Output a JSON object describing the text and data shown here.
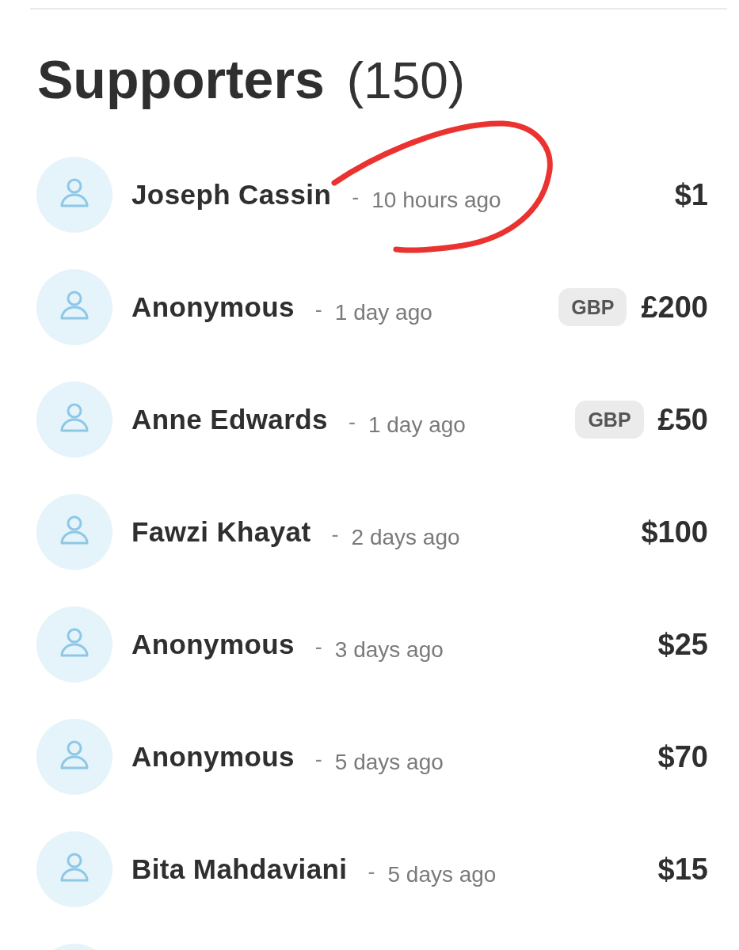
{
  "header": {
    "title": "Supporters",
    "count": "(150)"
  },
  "rows": [
    {
      "name": "Joseph Cassin",
      "separator": "-",
      "time": "10 hours ago",
      "amount": "$1",
      "circled": true
    },
    {
      "name": "Anonymous",
      "separator": "-",
      "time": "1 day ago",
      "currency": "GBP",
      "amount": "£200",
      "circled": false
    },
    {
      "name": "Anne Edwards",
      "separator": "-",
      "time": "1 day ago",
      "currency": "GBP",
      "amount": "£50",
      "circled": false
    },
    {
      "name": "Fawzi Khayat",
      "separator": "-",
      "time": "2 days ago",
      "amount": "$100",
      "circled": false
    },
    {
      "name": "Anonymous",
      "separator": "-",
      "time": "3 days ago",
      "amount": "$25",
      "circled": false
    },
    {
      "name": "Anonymous",
      "separator": "-",
      "time": "5 days ago",
      "amount": "$70",
      "circled": false
    },
    {
      "name": "Bita Mahdaviani",
      "separator": "-",
      "time": "5 days ago",
      "amount": "$15",
      "circled": false
    }
  ]
}
